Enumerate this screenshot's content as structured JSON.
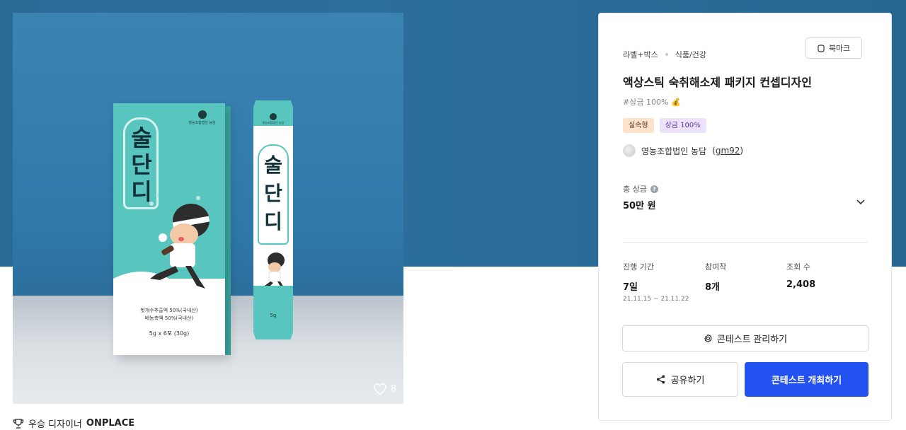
{
  "product_image": {
    "box_brand": "영농조합법인 농담",
    "box_title": "술\n단\n디",
    "box_info_line1": "헛개수추출액 50%(국내산)",
    "box_info_line2": "배농축액 50%(국내산)",
    "box_weight": "5g x 6포 (30g)",
    "stick_brand": "영농조합법인 농담",
    "stick_title": "술\n단\n디",
    "stick_weight": "5g",
    "likes_count": "8"
  },
  "award": {
    "prefix": "우승 디자이너",
    "designer": "ONPLACE"
  },
  "panel": {
    "category_primary": "라벨+박스",
    "category_secondary": "식품/건강",
    "bookmark_label": "북마크",
    "title": "액상스틱 숙취해소제 패키지 컨셉디자인",
    "hashtag": "#상금 100%",
    "badges": [
      "실속형",
      "상금 100%"
    ],
    "host_name": "영농조합법인 농담",
    "host_id": "gm92",
    "prize_label": "총 상금",
    "prize_value": "50만 원",
    "stats": [
      {
        "label": "진행 기간",
        "value": "7일",
        "sub": "21.11.15 ~ 21.11.22"
      },
      {
        "label": "참여작",
        "value": "8개",
        "sub": ""
      },
      {
        "label": "조회 수",
        "value": "2,408",
        "sub": ""
      }
    ],
    "manage_label": "콘테스트 관리하기",
    "share_label": "공유하기",
    "host_contest_label": "콘테스트 개최하기"
  },
  "colors": {
    "hero": "#2b6f9c",
    "primary_button": "#2452f0",
    "mint": "#58c5be"
  }
}
